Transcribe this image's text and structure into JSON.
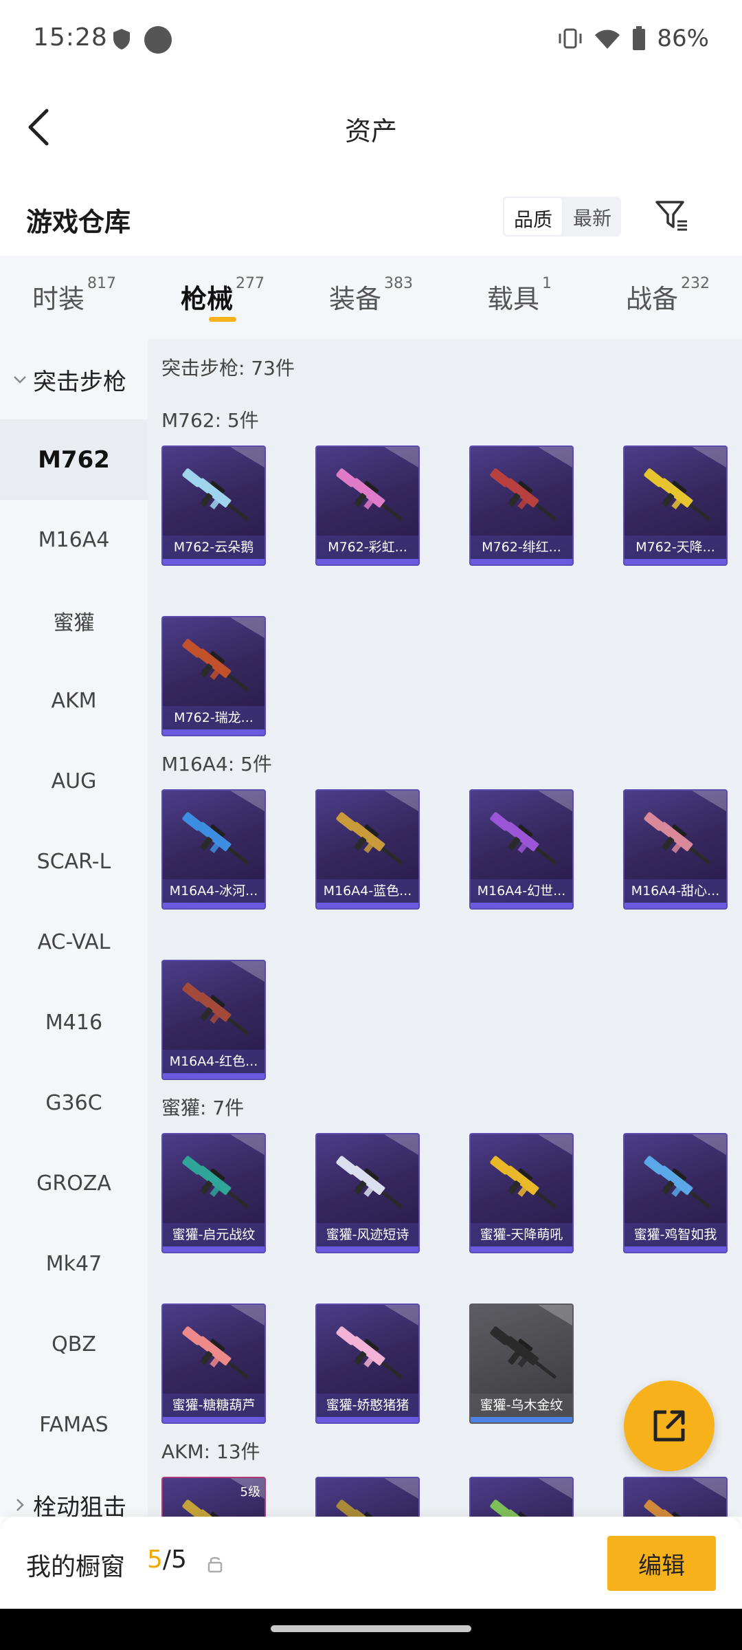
{
  "status_bar": {
    "time": "15:28",
    "battery": "86%"
  },
  "header": {
    "title": "资产"
  },
  "warehouse": {
    "title": "游戏仓库",
    "sort_options": [
      "品质",
      "最新"
    ]
  },
  "tabs": [
    {
      "label": "时装",
      "count": "817"
    },
    {
      "label": "枪械",
      "count": "277"
    },
    {
      "label": "装备",
      "count": "383"
    },
    {
      "label": "载具",
      "count": "1"
    },
    {
      "label": "战备",
      "count": "232"
    }
  ],
  "sidebar": {
    "category": "突击步枪",
    "items": [
      "M762",
      "M16A4",
      "蜜獾",
      "AKM",
      "AUG",
      "SCAR-L",
      "AC-VAL",
      "M416",
      "G36C",
      "GROZA",
      "Mk47",
      "QBZ",
      "FAMAS"
    ],
    "next_category": "栓动狙击"
  },
  "content": {
    "summary": "突击步枪: 73件",
    "groups": [
      {
        "title": "M762: 5件",
        "items": [
          "M762-云朵鹅",
          "M762-彩虹...",
          "M762-绯红...",
          "M762-天降...",
          "M762-瑞龙..."
        ]
      },
      {
        "title": "M16A4: 5件",
        "items": [
          "M16A4-冰河...",
          "M16A4-蓝色...",
          "M16A4-幻世...",
          "M16A4-甜心...",
          "M16A4-红色..."
        ]
      },
      {
        "title": "蜜獾: 7件",
        "items": [
          "蜜獾-启元战纹",
          "蜜獾-风迹短诗",
          "蜜獾-天降萌吼",
          "蜜獾-鸡智如我",
          "蜜獾-糖糖葫芦",
          "蜜獾-娇憨猪猪",
          "蜜獾-乌木金纹"
        ]
      },
      {
        "title": "AKM: 13件",
        "badge": "5级"
      }
    ]
  },
  "bottom": {
    "showcase_label": "我的橱窗",
    "current": "5",
    "total": "/5",
    "edit_label": "编辑"
  },
  "colors": {
    "accent": "#f7b21b",
    "card_purple": "#3a2b6b",
    "card_bar": "#6c5be0"
  },
  "icons": [
    "back-icon",
    "filter-icon",
    "lock-icon",
    "share-icon",
    "chevron-down-icon",
    "chevron-right-icon"
  ]
}
